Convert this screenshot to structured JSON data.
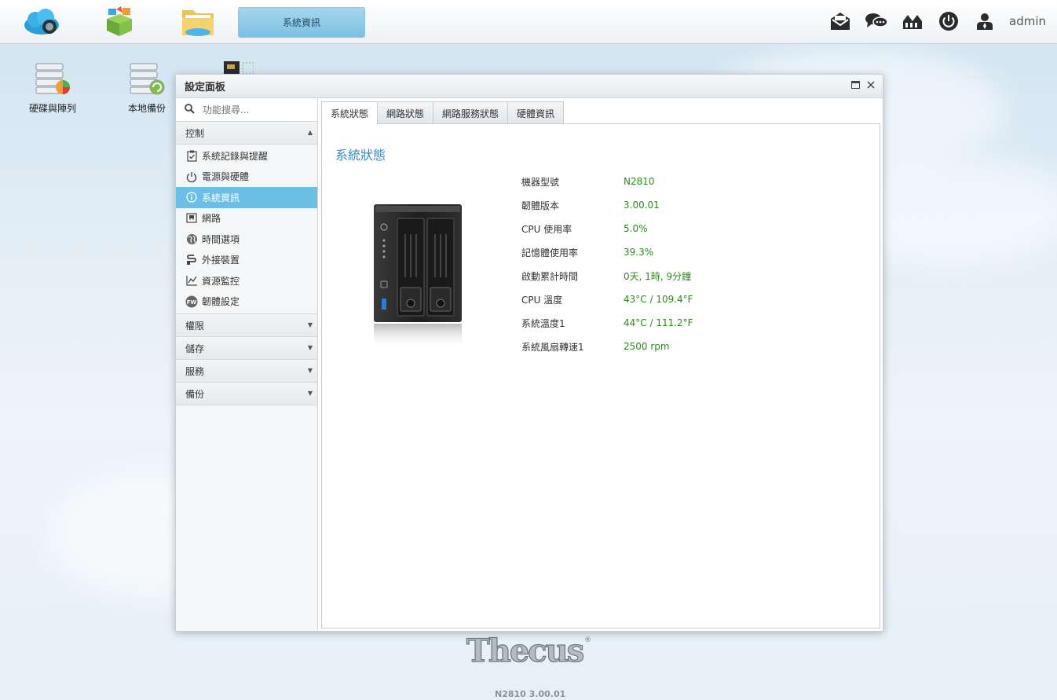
{
  "topbar": {
    "window_tab": "系統資訊",
    "user": "admin"
  },
  "desktop": {
    "icons": [
      {
        "label": "硬碟與陣列"
      },
      {
        "label": "本地備份"
      }
    ]
  },
  "window": {
    "title": "設定面板",
    "search_placeholder": "功能搜尋...",
    "sections": {
      "control": "控制",
      "permissions": "權限",
      "storage": "儲存",
      "services": "服務",
      "backup": "備份"
    },
    "nav": [
      {
        "label": "系統記錄與提醒",
        "icon": "checklist-icon"
      },
      {
        "label": "電源與硬體",
        "icon": "power-icon"
      },
      {
        "label": "系統資訊",
        "icon": "info-icon"
      },
      {
        "label": "網路",
        "icon": "network-icon"
      },
      {
        "label": "時間選項",
        "icon": "globe-icon"
      },
      {
        "label": "外接裝置",
        "icon": "usb-icon"
      },
      {
        "label": "資源監控",
        "icon": "chart-icon"
      },
      {
        "label": "韌體設定",
        "icon": "firmware-icon",
        "icon_text": "FW"
      }
    ],
    "tabs": [
      "系統狀態",
      "網路狀態",
      "網路服務狀態",
      "硬體資訊"
    ],
    "panel_title": "系統狀態",
    "info": [
      {
        "key": "機器型號",
        "value": "N2810"
      },
      {
        "key": "韌體版本",
        "value": "3.00.01"
      },
      {
        "key": "CPU 使用率",
        "value": "5.0%"
      },
      {
        "key": "記憶體使用率",
        "value": "39.3%"
      },
      {
        "key": "啟動累計時間",
        "value": "0天, 1時, 9分鐘"
      },
      {
        "key": "CPU 溫度",
        "value": "43°C / 109.4°F"
      },
      {
        "key": "系統溫度1",
        "value": "44°C / 111.2°F"
      },
      {
        "key": "系統風扇轉速1",
        "value": "2500 rpm"
      }
    ]
  },
  "footer": {
    "brand": "Thecus",
    "version": "N2810 3.00.01"
  },
  "colors": {
    "accent": "#6bbfe6",
    "value_green": "#2f8a1e",
    "title_blue": "#3a8cc0"
  }
}
